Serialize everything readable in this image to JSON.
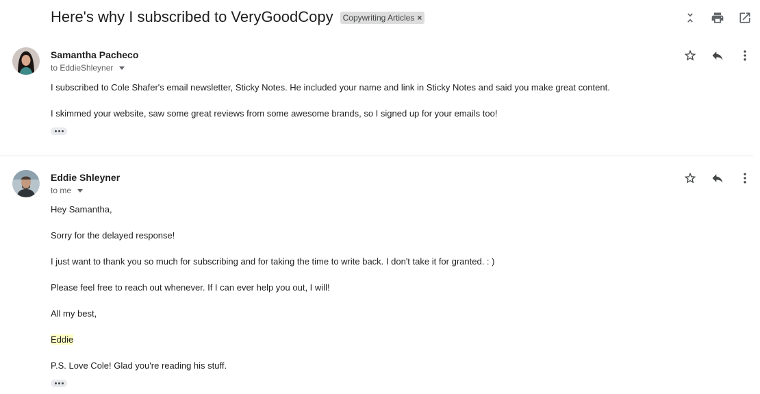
{
  "thread": {
    "subject": "Here's why I subscribed to VeryGoodCopy",
    "label": "Copywriting Articles",
    "label_remove": "×"
  },
  "toolbar": {
    "icons": [
      "collapse-all-icon",
      "print-icon",
      "open-in-new-window-icon"
    ]
  },
  "messages": [
    {
      "sender": "Samantha Pacheco",
      "recipient": "to EddieShleyner",
      "avatar": "avatar-samantha",
      "body": [
        "I subscribed to Cole Shafer's email newsletter, Sticky Notes. He included your name and link in Sticky Notes and said you make great content.",
        "I skimmed your website, saw some great reviews from some awesome brands, so I signed up for your emails too!"
      ]
    },
    {
      "sender": "Eddie Shleyner",
      "recipient": "to me",
      "avatar": "avatar-eddie",
      "body": [
        "Hey Samantha,",
        "Sorry for the delayed response!",
        "I just want to thank you so much for subscribing and for taking the time to write back. I don't take it for granted. : )",
        "Please feel free to reach out whenever. If I can ever help you out, I will!",
        "All my best,",
        "Eddie",
        "P.S. Love Cole! Glad you're reading his stuff."
      ]
    }
  ],
  "colors": {
    "highlight": "#fdfdc4",
    "chip_bg": "#dddddd",
    "icon": "#5f6368"
  }
}
